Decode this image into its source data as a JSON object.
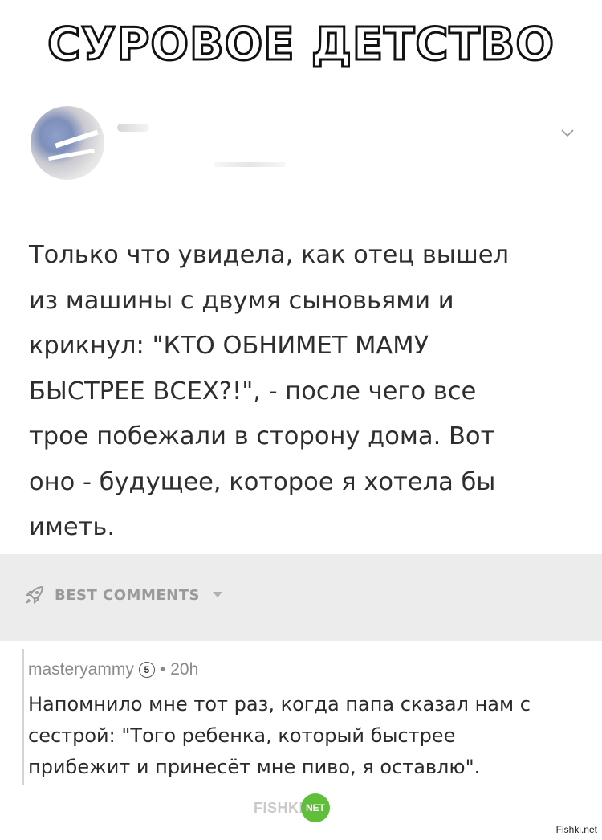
{
  "banner": {
    "title": "СУРОВОЕ ДЕТСТВО"
  },
  "post": {
    "lines": [
      "Только что увидела, как отец вышел",
      "из машины с двумя сыновьями и",
      "крикнул: \"КТО ОБНИМЕТ МАМУ",
      "БЫСТРЕЕ ВСЕХ?!\", - после чего все",
      "трое побежали в сторону дома. Вот",
      "оно - будущее, которое я хотела бы",
      "иметь."
    ],
    "icons": {
      "avatar": "avatar",
      "expand": "chevron-down-icon"
    }
  },
  "comments_section": {
    "label": "BEST COMMENTS"
  },
  "comment": {
    "username": "masteryammy",
    "badge": "5",
    "separator": "•",
    "time": "20h",
    "lines": [
      "Напомнило мне тот раз, когда папа сказал нам с",
      "сестрой: \"Того ребенка, который быстрее",
      "прибежит и принесёт мне пиво, я оставлю\"."
    ]
  },
  "footer": {
    "logo_text": "FISHKI",
    "logo_badge": "NET",
    "watermark": "Fishki.net"
  },
  "colors": {
    "body_text": "#2e2e2e",
    "muted": "#8a8a8a",
    "bar_bg": "#ececec",
    "brand_green": "#5fbf3b"
  }
}
